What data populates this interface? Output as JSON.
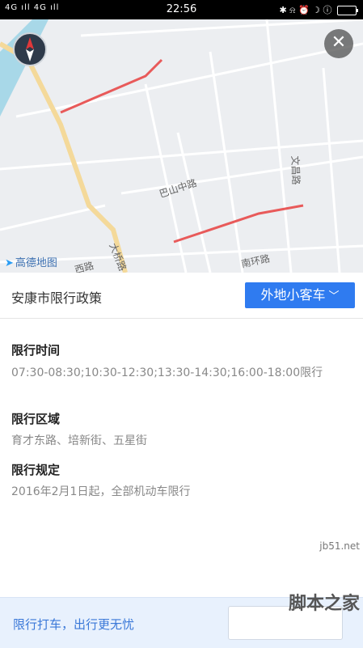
{
  "status_bar": {
    "signal_left": "4G ıll 4G ıll",
    "time": "22:56",
    "icons_right": "✱ ⍾ ⏰ ☽ ⓘ"
  },
  "map": {
    "logo_text": "高德地图",
    "road_labels": [
      "巴山中路",
      "文昌路",
      "大桥路",
      "南环路",
      "西路"
    ],
    "restricted_color": "#e85a5a",
    "main_road_color": "#f4d99a",
    "water_color": "#a8d8e8"
  },
  "header": {
    "title": "安康市限行政策",
    "vehicle_type": "外地小客车"
  },
  "sections": [
    {
      "title": "限行时间",
      "text": "07:30-08:30;10:30-12:30;13:30-14:30;16:00-18:00限行"
    },
    {
      "title": "限行区域",
      "text": "育才东路、培新街、五星街"
    },
    {
      "title": "限行规定",
      "text": "2016年2月1日起，全部机动车限行"
    }
  ],
  "bottom": {
    "text": "限行打车，出行更无忧"
  },
  "watermark": {
    "small": "jb51.net",
    "big": "脚本之家"
  }
}
